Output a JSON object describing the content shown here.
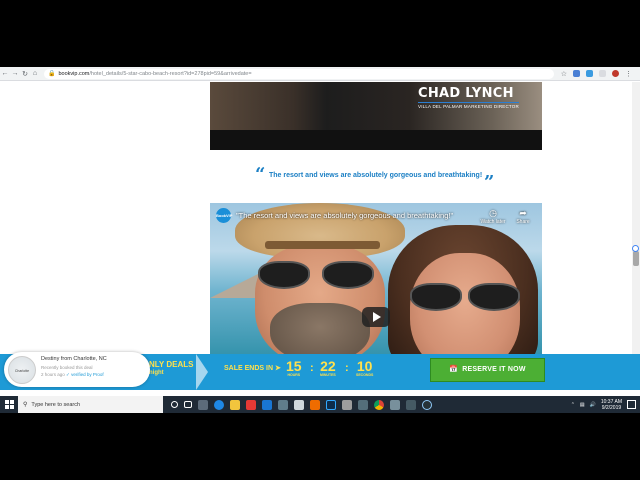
{
  "browser": {
    "url_domain": "bookvip.com",
    "url_path": "/hotel_details/5-star-cabo-beach-resort?id=278pid=59&arrivedate=",
    "back_icon": "back-arrow-icon",
    "forward_icon": "forward-arrow-icon",
    "reload_icon": "reload-icon",
    "home_icon": "home-icon"
  },
  "top_video": {
    "name": "CHAD LYNCH",
    "role": "VILLA DEL PALMAR MARKETING DIRECTOR"
  },
  "testimonial": {
    "quote": "The resort and views are absolutely gorgeous and breathtaking!"
  },
  "main_video": {
    "title": "\"The resort and views are absolutely gorgeous and breathtaking!\"",
    "logo_text": "BookVIP",
    "watch_later": "Watch later",
    "share": "Share"
  },
  "social_proof": {
    "name": "Destiny from Charlotte, NC",
    "action": "Recently booked this deal",
    "time": "2 hours ago",
    "verified": "verified by Proof",
    "map_label": "Charlotte"
  },
  "promo": {
    "deals_line1": "NLY DEALS",
    "deals_line2": "night",
    "sale_ends": "SALE ENDS IN",
    "hours": "15",
    "hours_label": "HOURS",
    "minutes": "22",
    "minutes_label": "MINUTES",
    "seconds": "10",
    "seconds_label": "SECONDS",
    "reserve_label": "RESERVE IT NOW"
  },
  "taskbar": {
    "search_placeholder": "Type here to search",
    "time": "10:37 AM",
    "date": "9/2/2019"
  },
  "colors": {
    "brand_blue": "#1e9ad6",
    "accent_yellow": "#ffe14d",
    "reserve_green": "#4caf34"
  }
}
